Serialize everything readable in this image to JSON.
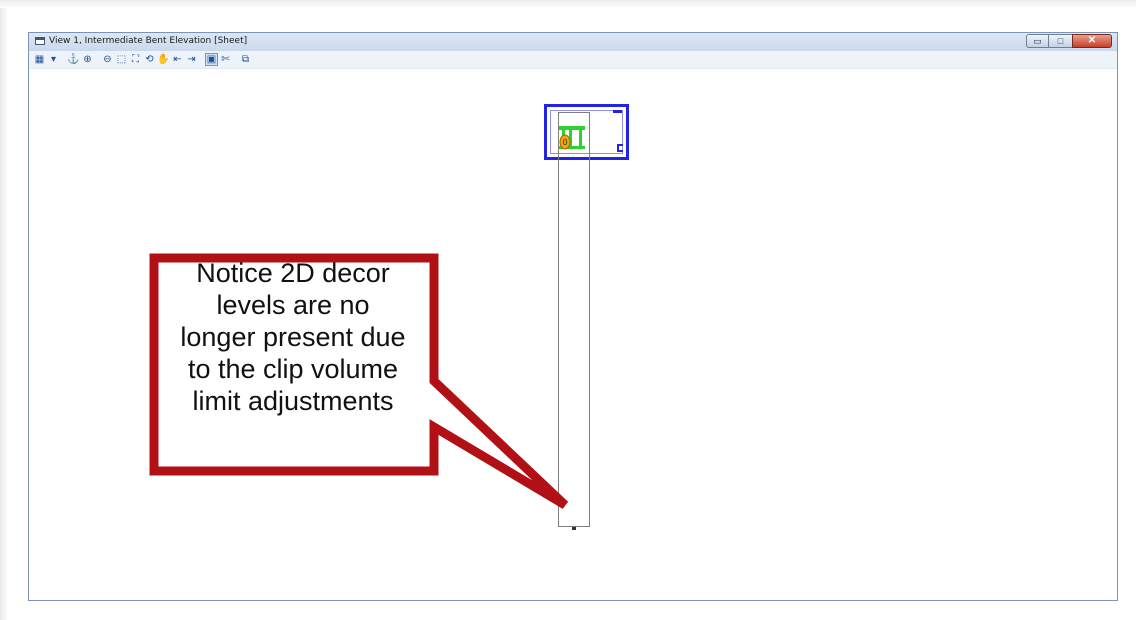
{
  "window": {
    "title": "View 1, Intermediate Bent Elevation [Sheet]",
    "controls": {
      "minimize_symbol": "▭",
      "maximize_symbol": "□",
      "close_symbol": "✕"
    }
  },
  "toolbar": {
    "buttons": [
      {
        "name": "view-attributes-icon",
        "glyph": "▦"
      },
      {
        "name": "dropdown-arrow-icon",
        "glyph": "▾"
      },
      {
        "name": "update-view-icon",
        "glyph": "⚓"
      },
      {
        "name": "zoom-in-icon",
        "glyph": "⊕"
      },
      {
        "name": "zoom-out-icon",
        "glyph": "⊖"
      },
      {
        "name": "window-area-icon",
        "glyph": "⬚"
      },
      {
        "name": "fit-view-icon",
        "glyph": "⛶"
      },
      {
        "name": "rotate-view-icon",
        "glyph": "⟲"
      },
      {
        "name": "pan-view-icon",
        "glyph": "✋"
      },
      {
        "name": "previous-view-icon",
        "glyph": "⇤"
      },
      {
        "name": "next-view-icon",
        "glyph": "⇥"
      },
      {
        "name": "clip-volume-icon",
        "glyph": "▣"
      },
      {
        "name": "view-display-mode-icon",
        "glyph": "✄"
      },
      {
        "name": "copy-view-icon",
        "glyph": "⧉"
      }
    ]
  },
  "colors": {
    "callout_border": "#b11116",
    "sheet_border": "#2323e8",
    "drawing_green": "#2fd12f",
    "drawing_orange": "#f0a70f",
    "clip_volume_line": "#7f7f7f"
  },
  "callout": {
    "lines": [
      "Notice 2D decor",
      "levels are no",
      "longer present due",
      "to the clip volume",
      "limit adjustments"
    ]
  }
}
